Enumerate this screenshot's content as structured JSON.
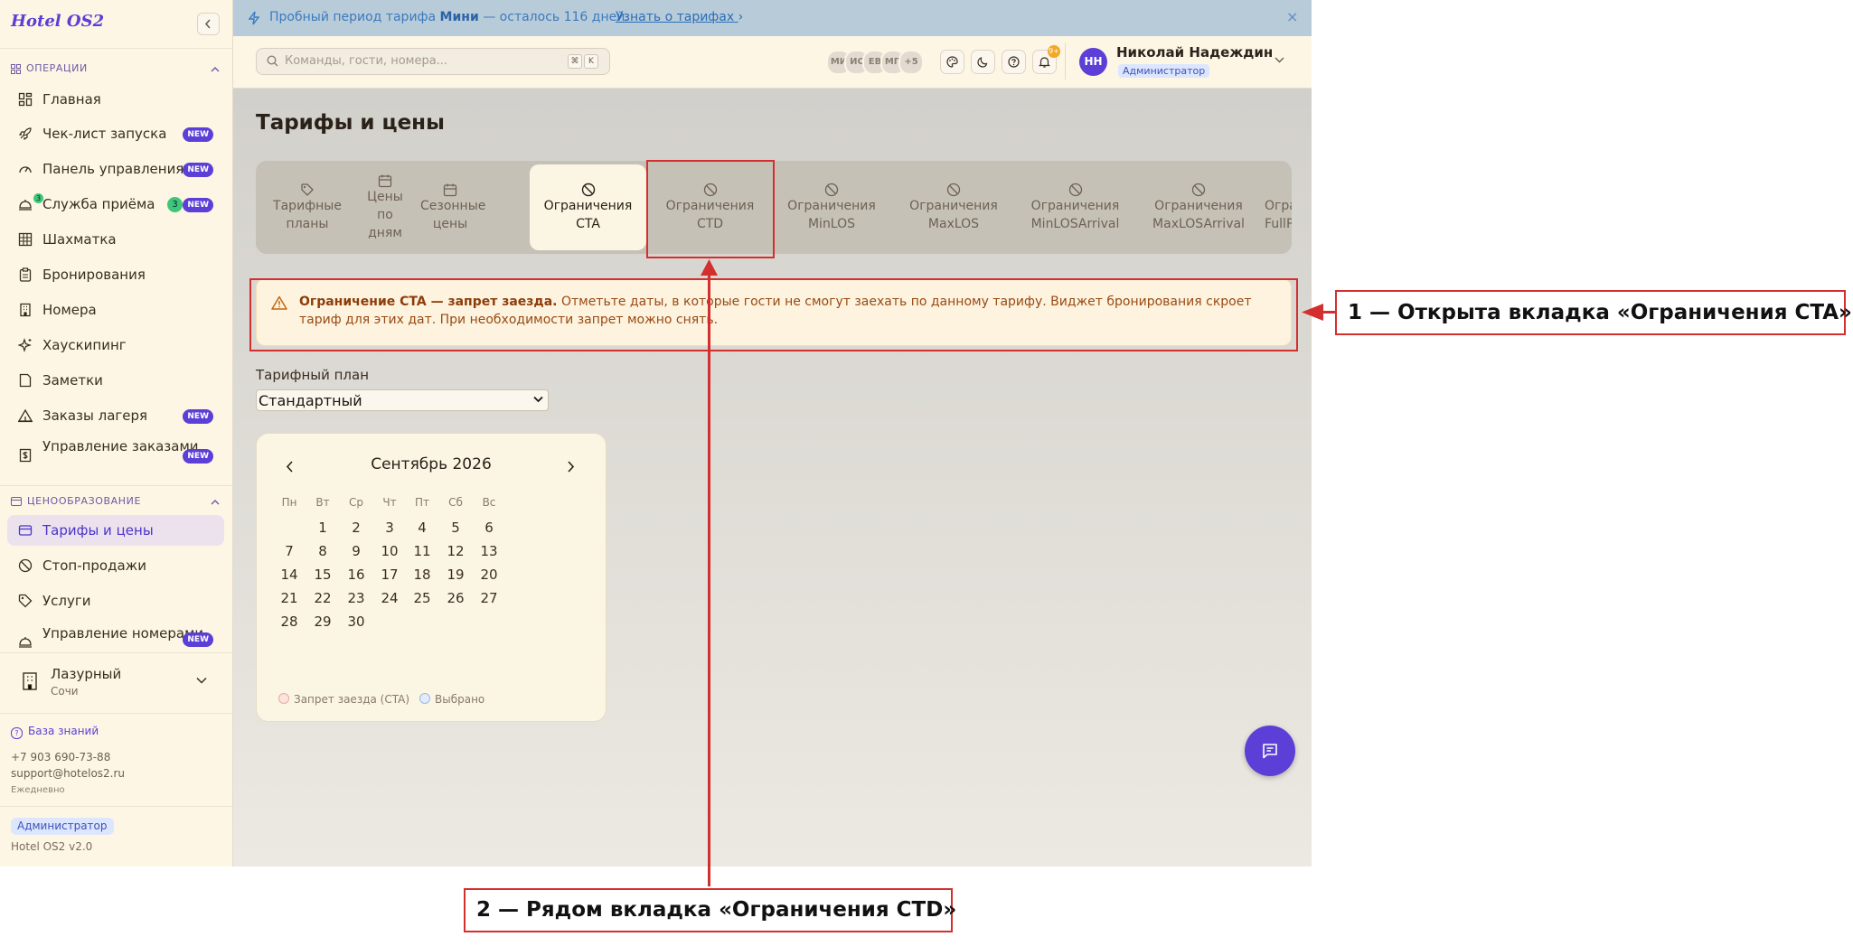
{
  "sidebar": {
    "brand": "Hotel OS2",
    "sections": {
      "operations": "ОПЕРАЦИИ",
      "pricing": "ЦЕНООБРАЗОВАНИЕ"
    },
    "items": [
      {
        "label": "Главная",
        "icon": "grid-icon"
      },
      {
        "label": "Чек-лист запуска",
        "icon": "rocket-icon",
        "badge": "NEW"
      },
      {
        "label": "Панель управления",
        "icon": "gauge-icon",
        "badge": "NEW"
      },
      {
        "label": "Служба приёма",
        "icon": "bell-icon",
        "badge": "NEW",
        "count": "3",
        "mini_count": "3"
      },
      {
        "label": "Шахматка",
        "icon": "table-icon"
      },
      {
        "label": "Бронирования",
        "icon": "clipboard-icon"
      },
      {
        "label": "Номера",
        "icon": "building-icon"
      },
      {
        "label": "Хаускипинг",
        "icon": "sparkle-icon"
      },
      {
        "label": "Заметки",
        "icon": "note-icon"
      },
      {
        "label": "Заказы лагеря",
        "icon": "tent-icon",
        "badge": "NEW"
      },
      {
        "label": "Управление заказами",
        "icon": "receipt-icon",
        "badge": "NEW"
      },
      {
        "label": "Тарифы и цены",
        "icon": "card-icon"
      },
      {
        "label": "Стоп-продажи",
        "icon": "ban-icon"
      },
      {
        "label": "Услуги",
        "icon": "tag-icon"
      },
      {
        "label": "Управление номерами",
        "icon": "bell-icon",
        "badge": "NEW"
      }
    ],
    "hotel": {
      "name": "Лазурный",
      "city": "Сочи"
    },
    "knowledge_base": "База знаний",
    "phone": "+7 903 690-73-88",
    "email": "support@hotelos2.ru",
    "hours": "Ежедневно",
    "role": "Администратор",
    "version": "Hotel OS2 v2.0"
  },
  "banner": {
    "text_prefix": "Пробный период тарифа",
    "plan": "Мини",
    "text_suffix": "— осталось 116 дней.",
    "link": "Узнать о тарифах",
    "close": "×"
  },
  "topbar": {
    "search_placeholder": "Команды, гости, номера...",
    "shortcut_keys": [
      "⌘",
      "K"
    ],
    "avatars": [
      "МИ",
      "ИС",
      "ЕВ",
      "МП",
      "+5"
    ],
    "notifications": "9+",
    "user_initials": "НН",
    "user_name": "Николай Надеждин",
    "user_role": "Администратор"
  },
  "main": {
    "title": "Тарифы и цены",
    "tabs": [
      {
        "label": "Тарифные планы",
        "icon": "tag-icon"
      },
      {
        "label": "Цены по дням",
        "icon": "calendar-icon"
      },
      {
        "label": "Сезонные цены",
        "icon": "calendar-icon"
      },
      {
        "label": "Ограничения CTA",
        "icon": "ban-icon",
        "active": true
      },
      {
        "label": "Ограничения CTD",
        "icon": "ban-icon"
      },
      {
        "label": "Ограничения MinLOS",
        "icon": "ban-icon"
      },
      {
        "label": "Ограничения MaxLOS",
        "icon": "ban-icon"
      },
      {
        "label": "Ограничения MinLOSArrival",
        "icon": "ban-icon"
      },
      {
        "label": "Ограничения MaxLOSArrival",
        "icon": "ban-icon"
      },
      {
        "label": "Ограничения FullPa",
        "icon": "ban-icon"
      }
    ],
    "alert": {
      "title": "Ограничение CTA — запрет заезда.",
      "body": "Отметьте даты, в которые гости не смогут заехать по данному тарифу. Виджет бронирования скроет тариф для этих дат. При необходимости запрет можно снять."
    },
    "rate_plan_label": "Тарифный план",
    "rate_plan_value": "Стандартный",
    "calendar": {
      "month": "Сентябрь 2026",
      "weekdays": [
        "Пн",
        "Вт",
        "Ср",
        "Чт",
        "Пт",
        "Сб",
        "Вс"
      ],
      "weeks": [
        [
          "",
          "1",
          "2",
          "3",
          "4",
          "5",
          "6"
        ],
        [
          "7",
          "8",
          "9",
          "10",
          "11",
          "12",
          "13"
        ],
        [
          "14",
          "15",
          "16",
          "17",
          "18",
          "19",
          "20"
        ],
        [
          "21",
          "22",
          "23",
          "24",
          "25",
          "26",
          "27"
        ],
        [
          "28",
          "29",
          "30",
          "",
          "",
          "",
          ""
        ]
      ],
      "legend_cta": "Запрет заезда (CTA)",
      "legend_selected": "Выбрано"
    }
  },
  "annotations": {
    "first": "1 — Открыта вкладка «Ограничения CTA»",
    "second": "2 — Рядом вкладка «Ограничения CTD»"
  },
  "colors": {
    "accent": "#5b3fd6",
    "highlight": "#d32f2f",
    "new_badge": "#5b3fd6",
    "count_badge": "#3ec77a"
  }
}
